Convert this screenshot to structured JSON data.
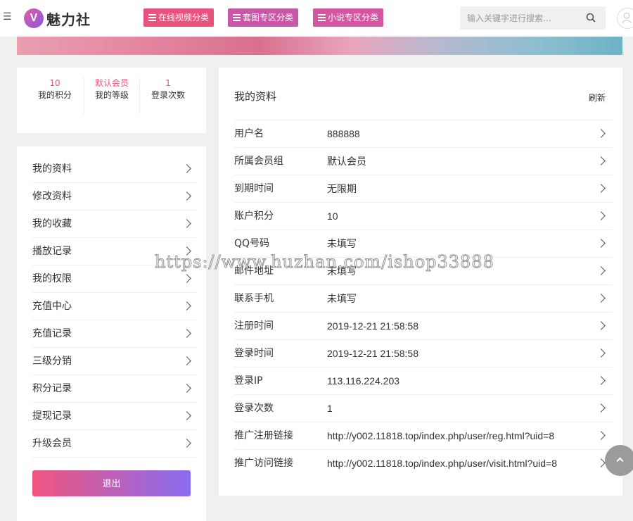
{
  "header": {
    "logo_badge": "V",
    "logo_text": "魅力社",
    "categories": [
      {
        "label": "在线视频分类"
      },
      {
        "label": "套图专区分类"
      },
      {
        "label": "小说专区分类"
      }
    ],
    "search_placeholder": "输入关键字进行搜索..."
  },
  "stats": [
    {
      "value": "10",
      "label": "我的积分"
    },
    {
      "value": "默认会员",
      "label": "我的等级"
    },
    {
      "value": "1",
      "label": "登录次数"
    }
  ],
  "side_menu": {
    "items": [
      {
        "label": "我的资料"
      },
      {
        "label": "修改资料"
      },
      {
        "label": "我的收藏"
      },
      {
        "label": "播放记录"
      },
      {
        "label": "我的权限"
      },
      {
        "label": "充值中心"
      },
      {
        "label": "充值记录"
      },
      {
        "label": "三级分销"
      },
      {
        "label": "积分记录"
      },
      {
        "label": "提现记录"
      },
      {
        "label": "升级会员"
      }
    ],
    "logout_label": "退出"
  },
  "profile": {
    "title": "我的资料",
    "refresh_label": "刷新",
    "rows": [
      {
        "key": "用户名",
        "value": "888888"
      },
      {
        "key": "所属会员组",
        "value": "默认会员"
      },
      {
        "key": "到期时间",
        "value": "无限期"
      },
      {
        "key": "账户积分",
        "value": "10"
      },
      {
        "key": "QQ号码",
        "value": "未填写"
      },
      {
        "key": "邮件地址",
        "value": "未填写"
      },
      {
        "key": "联系手机",
        "value": "未填写"
      },
      {
        "key": "注册时间",
        "value": "2019-12-21 21:58:58"
      },
      {
        "key": "登录时间",
        "value": "2019-12-21 21:58:58"
      },
      {
        "key": "登录IP",
        "value": "113.116.224.203"
      },
      {
        "key": "登录次数",
        "value": "1"
      },
      {
        "key": "推广注册链接",
        "value": "http://y002.11818.top/index.php/user/reg.html?uid=8"
      },
      {
        "key": "推广访问链接",
        "value": "http://y002.11818.top/index.php/user/visit.html?uid=8"
      }
    ]
  },
  "watermark": "https://www.huzhan.com/ishop33888"
}
